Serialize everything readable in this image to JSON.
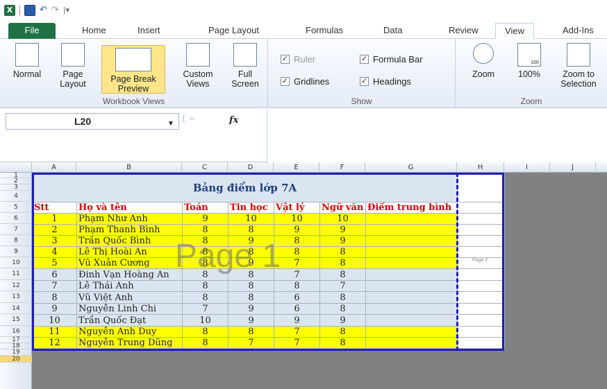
{
  "qat": {
    "excel_icon": "X",
    "undo": "↶",
    "redo": "↷",
    "customize": "|▾"
  },
  "tabs": [
    "File",
    "Home",
    "Insert",
    "Page Layout",
    "Formulas",
    "Data",
    "Review",
    "View",
    "Add-Ins"
  ],
  "ribbon": {
    "workbook_views": {
      "label": "Workbook Views",
      "normal": "Normal",
      "page_layout": [
        "Page",
        "Layout"
      ],
      "page_break": [
        "Page Break",
        "Preview"
      ],
      "custom": [
        "Custom",
        "Views"
      ],
      "full": [
        "Full",
        "Screen"
      ]
    },
    "show": {
      "label": "Show",
      "ruler": "Ruler",
      "formula_bar": "Formula Bar",
      "gridlines": "Gridlines",
      "headings": "Headings"
    },
    "zoom": {
      "label": "Zoom",
      "zoom": "Zoom",
      "hundred": "100%",
      "hundred_icon": "100",
      "zoom_sel": [
        "Zoom to",
        "Selection"
      ]
    }
  },
  "formula_bar": {
    "name_box": "L20",
    "fx": "fx",
    "content": ""
  },
  "sheet": {
    "columns": [
      "A",
      "B",
      "C",
      "D",
      "E",
      "F",
      "G",
      "H",
      "I",
      "J"
    ],
    "rows": [
      "1",
      "2",
      "3",
      "4",
      "5",
      "6",
      "7",
      "8",
      "9",
      "10",
      "11",
      "12",
      "13",
      "14",
      "15",
      "16",
      "17",
      "18",
      "19",
      "20"
    ],
    "title": "Bảng điểm lớp 7A",
    "headers": [
      "Stt",
      "Họ và tên",
      "Toán",
      "Tin học",
      "Vật lý",
      "Ngữ văn",
      "Điểm trung bình"
    ],
    "data": [
      [
        "1",
        "Phạm Như Anh",
        "9",
        "10",
        "10",
        "10"
      ],
      [
        "2",
        "Phạm Thanh Bình",
        "8",
        "8",
        "9",
        "9"
      ],
      [
        "3",
        "Trần Quốc Bình",
        "8",
        "9",
        "8",
        "9"
      ],
      [
        "4",
        "Lê Thị Hoài An",
        "8",
        "8",
        "8",
        "8"
      ],
      [
        "5",
        "Vũ Xuân Cương",
        "8",
        "9",
        "7",
        "8"
      ],
      [
        "6",
        "Đinh Vạn Hoàng An",
        "8",
        "8",
        "7",
        "8"
      ],
      [
        "7",
        "Lê Thái Anh",
        "8",
        "8",
        "8",
        "7"
      ],
      [
        "8",
        "Vũ Việt Anh",
        "8",
        "8",
        "6",
        "8"
      ],
      [
        "9",
        "Nguyễn Linh Chi",
        "7",
        "9",
        "6",
        "8"
      ],
      [
        "10",
        "Trần Quốc Đạt",
        "10",
        "9",
        "9",
        "9"
      ],
      [
        "11",
        "Nguyễn Anh Duy",
        "8",
        "8",
        "7",
        "8"
      ],
      [
        "12",
        "Nguyễn Trung Dũng",
        "8",
        "7",
        "7",
        "8"
      ]
    ],
    "yellow_rows": [
      true,
      true,
      true,
      true,
      true,
      false,
      false,
      false,
      false,
      false,
      true,
      true
    ],
    "watermark_page1": "Page 1",
    "watermark_page2": "Page 2"
  },
  "colors": {
    "excel_green": "#1f7244",
    "highlight": "#ffff00",
    "header_red": "#e00000",
    "title_blue": "#dbe5f1",
    "page_border": "#1f1fb3"
  }
}
